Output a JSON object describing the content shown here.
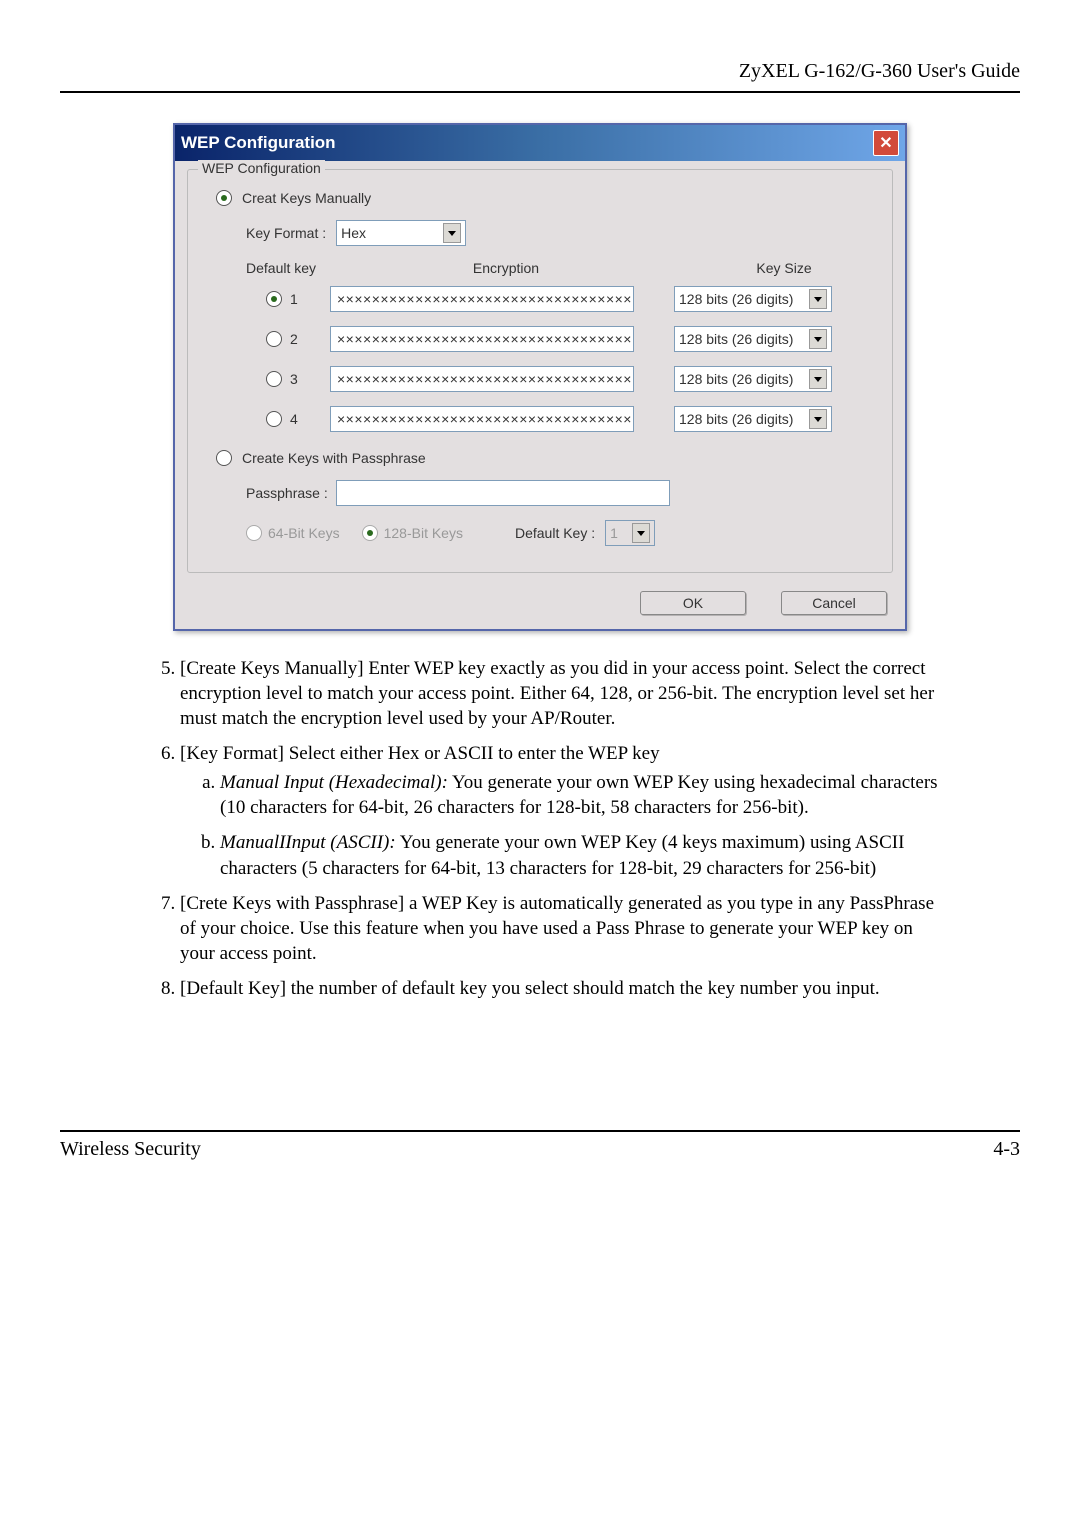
{
  "header": {
    "title": "ZyXEL G-162/G-360 User's Guide"
  },
  "dialog": {
    "title": "WEP Configuration",
    "group_legend": "WEP Configuration",
    "manual_radio_label": "Creat Keys Manually",
    "key_format_label": "Key Format :",
    "key_format_value": "Hex",
    "headers": {
      "default_key": "Default key",
      "encryption": "Encryption",
      "key_size": "Key Size"
    },
    "keys": [
      {
        "num": "1",
        "value": "××××××××××××××××××××××××××××××××××",
        "size": "128 bits (26 digits)"
      },
      {
        "num": "2",
        "value": "××××××××××××××××××××××××××××××××××",
        "size": "128 bits (26 digits)"
      },
      {
        "num": "3",
        "value": "××××××××××××××××××××××××××××××××××",
        "size": "128 bits (26 digits)"
      },
      {
        "num": "4",
        "value": "××××××××××××××××××××××××××××××××××",
        "size": "128 bits (26 digits)"
      }
    ],
    "passphrase_radio_label": "Create Keys with Passphrase",
    "passphrase_label": "Passphrase :",
    "bits64_label": "64-Bit Keys",
    "bits128_label": "128-Bit Keys",
    "default_key_label": "Default Key :",
    "default_key_value": "1",
    "ok": "OK",
    "cancel": "Cancel"
  },
  "body": {
    "item5": "[Create Keys Manually] Enter WEP key exactly as you did in your access point.  Select the correct encryption level to match your access point.  Either 64, 128, or 256-bit.  The encryption level set her must match the encryption level used by your AP/Router.",
    "item6": "[Key Format] Select either Hex or ASCII to enter the WEP key",
    "item6a_em": "Manual Input (Hexadecimal):",
    "item6a_rest": " You generate your own WEP Key using hexadecimal characters (10 characters for 64-bit, 26 characters for 128-bit, 58 characters for 256-bit).",
    "item6b_em": "ManualIInput (ASCII):",
    "item6b_rest": " You generate your own WEP Key (4 keys maximum) using ASCII characters (5 characters for 64-bit, 13 characters for 128-bit, 29 characters for 256-bit)",
    "item7": "[Crete Keys with Passphrase] a WEP Key is automatically generated as you type in any PassPhrase of your choice.  Use this feature when you have used a Pass Phrase to generate your WEP key on your access point.",
    "item8": "[Default Key] the number of default key you select should match the key number you input."
  },
  "footer": {
    "section": "Wireless Security",
    "page": "4-3"
  }
}
